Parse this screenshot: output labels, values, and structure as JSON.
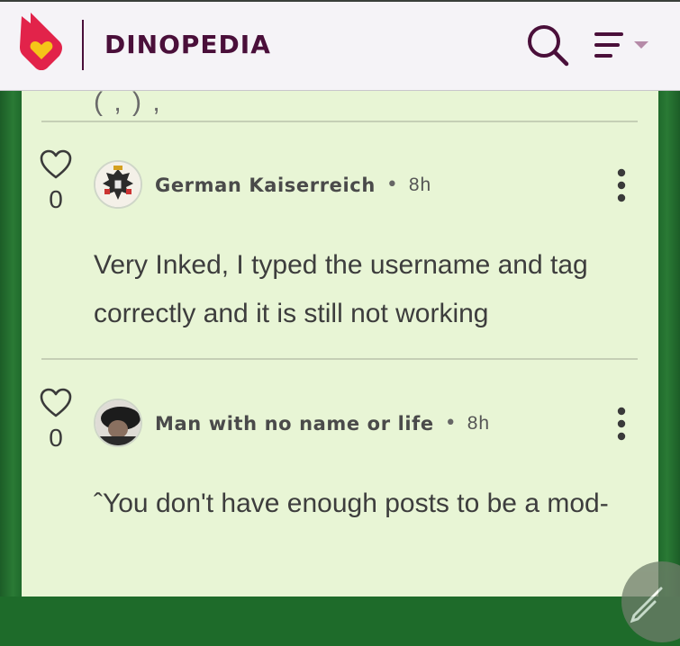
{
  "header": {
    "site_title": "DINOPEDIA",
    "icons": [
      "fandom-logo-icon",
      "search-icon",
      "menu-icon"
    ]
  },
  "comments": [
    {
      "likes": "0",
      "username": "German Kaiserreich",
      "separator": "•",
      "time": "8h",
      "text": "Very Inked, I typed the username and tag correctly and it is still not working"
    },
    {
      "likes": "0",
      "username": "Man with no name or life",
      "separator": "•",
      "time": "8h",
      "text": "ˆYou don't have enough posts to be a mod-"
    }
  ],
  "colors": {
    "brand": "#4a0f3a",
    "card_bg": "#e8f5d5",
    "page_bg": "#1e6b2a",
    "logo_red": "#e2234a",
    "logo_yellow": "#f5c518"
  }
}
